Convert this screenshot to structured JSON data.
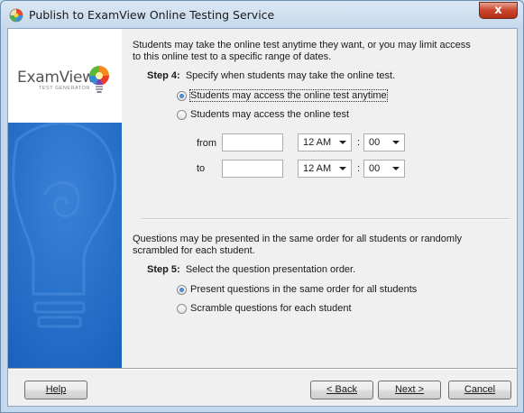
{
  "window": {
    "title": "Publish to ExamView Online Testing Service",
    "close_label": "x"
  },
  "logo": {
    "name": "ExamView",
    "subtitle": "TEST GENERATOR"
  },
  "access": {
    "description_line1": "Students may take the online test anytime they want, or you may limit access",
    "description_line2": "to this online test to a specific range of dates.",
    "step_label": "Step 4:",
    "step_text": "Specify when students may take the online test.",
    "option_anytime": "Students may access the online test anytime",
    "option_limited": "Students may access the online test",
    "selected": "anytime",
    "from_label": "from",
    "to_label": "to",
    "from_date": "",
    "to_date": "",
    "from_hour": "12 AM",
    "from_minute": "00",
    "to_hour": "12 AM",
    "to_minute": "00",
    "colon": ":"
  },
  "order": {
    "description_line1": "Questions may be presented in the same order for all students or randomly",
    "description_line2": "scrambled for each student.",
    "step_label": "Step 5:",
    "step_text": "Select the question presentation order.",
    "option_same": "Present questions in the same order for all students",
    "option_scramble": "Scramble questions for each student",
    "selected": "same"
  },
  "buttons": {
    "help": "Help",
    "back": "< Back",
    "next": "Next >",
    "cancel": "Cancel"
  }
}
